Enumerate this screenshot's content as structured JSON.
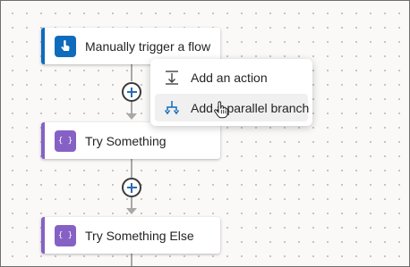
{
  "canvas": {
    "dot_color": "#bdbdbd",
    "background": "#faf9f8"
  },
  "flow": {
    "steps": [
      {
        "label": "Manually trigger a flow",
        "icon": "hand-tap-icon",
        "accent": "#0f6cbd"
      },
      {
        "label": "Try Something",
        "icon": "scope-braces-icon",
        "accent": "#8661c5"
      },
      {
        "label": "Try Something Else",
        "icon": "scope-braces-icon",
        "accent": "#8661c5"
      }
    ],
    "connector_color": "#a8a8a8",
    "add_button_icon": "plus-icon"
  },
  "context_menu": {
    "items": [
      {
        "label": "Add an action",
        "icon": "add-action-icon",
        "hovered": false
      },
      {
        "label": "Add a parallel branch",
        "icon": "parallel-branch-icon",
        "hovered": true
      }
    ]
  },
  "cursor": "hand-pointer-icon"
}
